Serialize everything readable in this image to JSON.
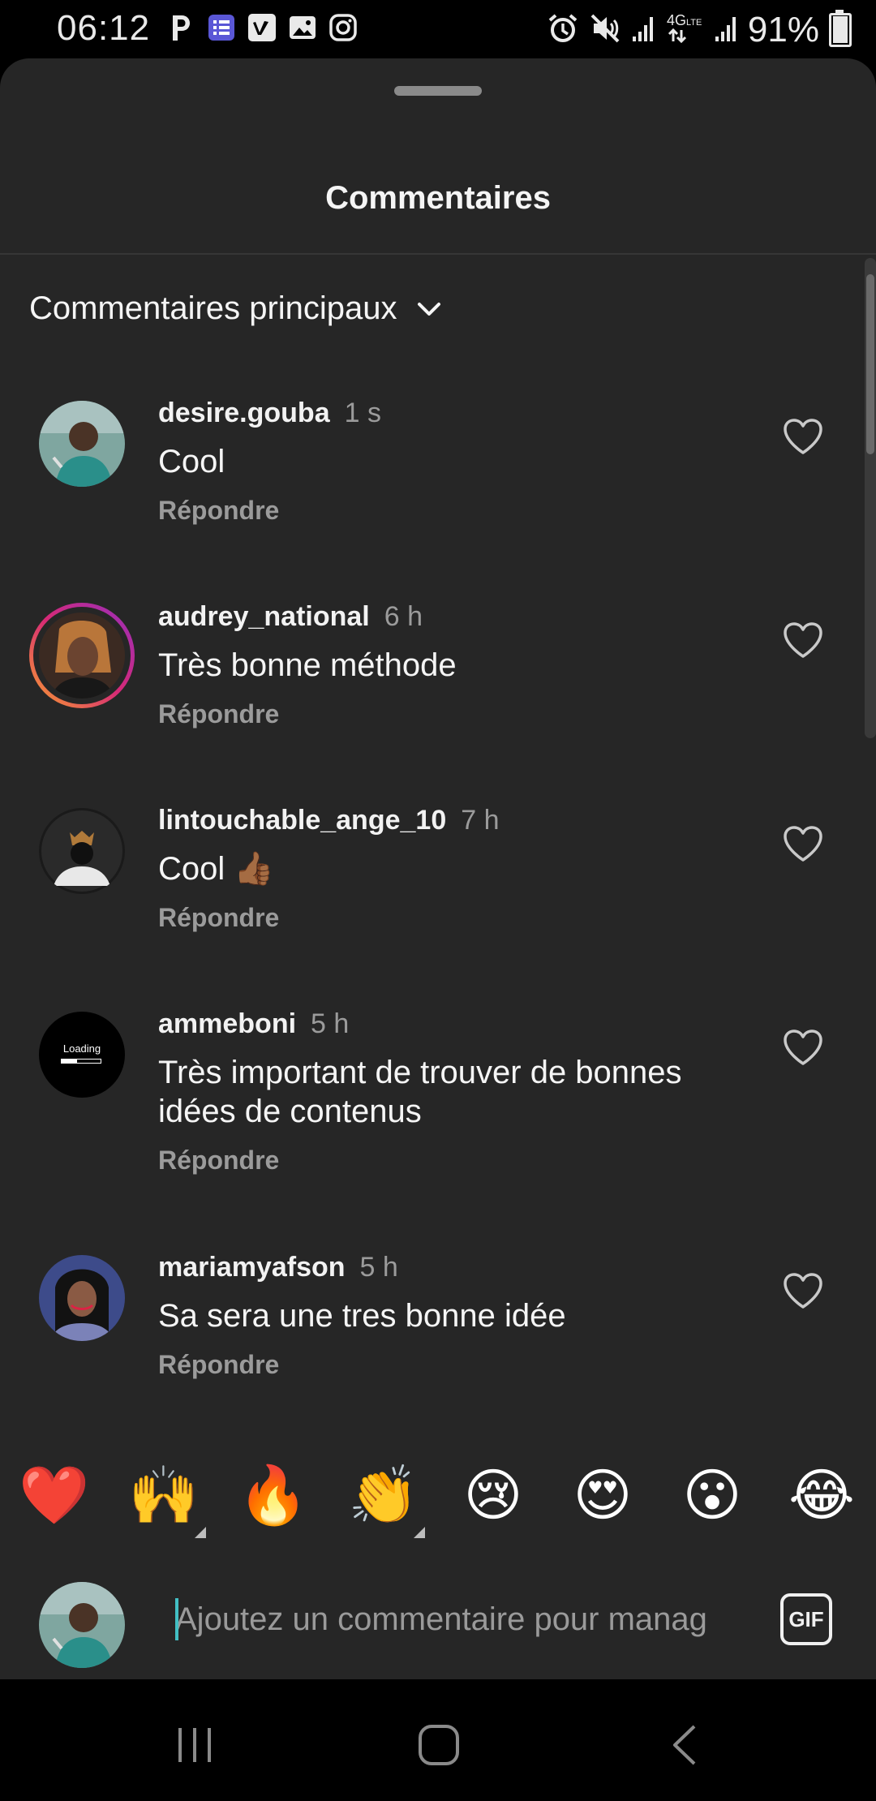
{
  "status_bar": {
    "time": "06:12",
    "left_icons": [
      "parking-icon",
      "tasks-icon",
      "vimeo-icon",
      "gallery-icon",
      "instagram-icon"
    ],
    "right_icons": [
      "alarm-icon",
      "mute-icon",
      "signal-icon",
      "4g-lte-icon",
      "signal-icon"
    ],
    "battery": "91%",
    "battery_level": 0.91
  },
  "sheet": {
    "title": "Commentaires",
    "sort_label": "Commentaires principaux"
  },
  "comments": [
    {
      "username": "desire.gouba",
      "time": "1 s",
      "text": "Cool",
      "reply": "Répondre",
      "avatar": "avatar-photo",
      "story_ring": false
    },
    {
      "username": "audrey_national",
      "time": "6 h",
      "text": "Très bonne méthode",
      "reply": "Répondre",
      "avatar": "avatar-photo",
      "story_ring": true
    },
    {
      "username": "lintouchable_ange_10",
      "time": "7 h",
      "text": "Cool 👍🏾",
      "reply": "Répondre",
      "avatar": "avatar-photo",
      "story_ring": false
    },
    {
      "username": "ammeboni",
      "time": "5 h",
      "text": "Très important de trouver de bonnes idées de contenus",
      "reply": "Répondre",
      "avatar": "avatar-loading",
      "avatar_text": "Loading",
      "story_ring": false
    },
    {
      "username": "mariamyafson",
      "time": "5 h",
      "text": "Sa sera une tres bonne idée",
      "reply": "Répondre",
      "avatar": "avatar-photo",
      "story_ring": false
    }
  ],
  "emoji_bar": [
    "❤️",
    "🙌",
    "🔥",
    "👏",
    "😢",
    "😍",
    "😮",
    "😂"
  ],
  "composer": {
    "placeholder": "Ajoutez un commentaire pour manag",
    "gif_label": "GIF"
  },
  "nav_bar": [
    "recent-apps-icon",
    "home-icon",
    "back-icon"
  ],
  "colors": {
    "sheet_bg": "#262626",
    "text_primary": "#f5f5f5",
    "text_secondary": "#9b9b9b",
    "caret": "#42bfc4",
    "story_ring_gradient": [
      "#f9a12e",
      "#d62976",
      "#962fbf"
    ]
  }
}
